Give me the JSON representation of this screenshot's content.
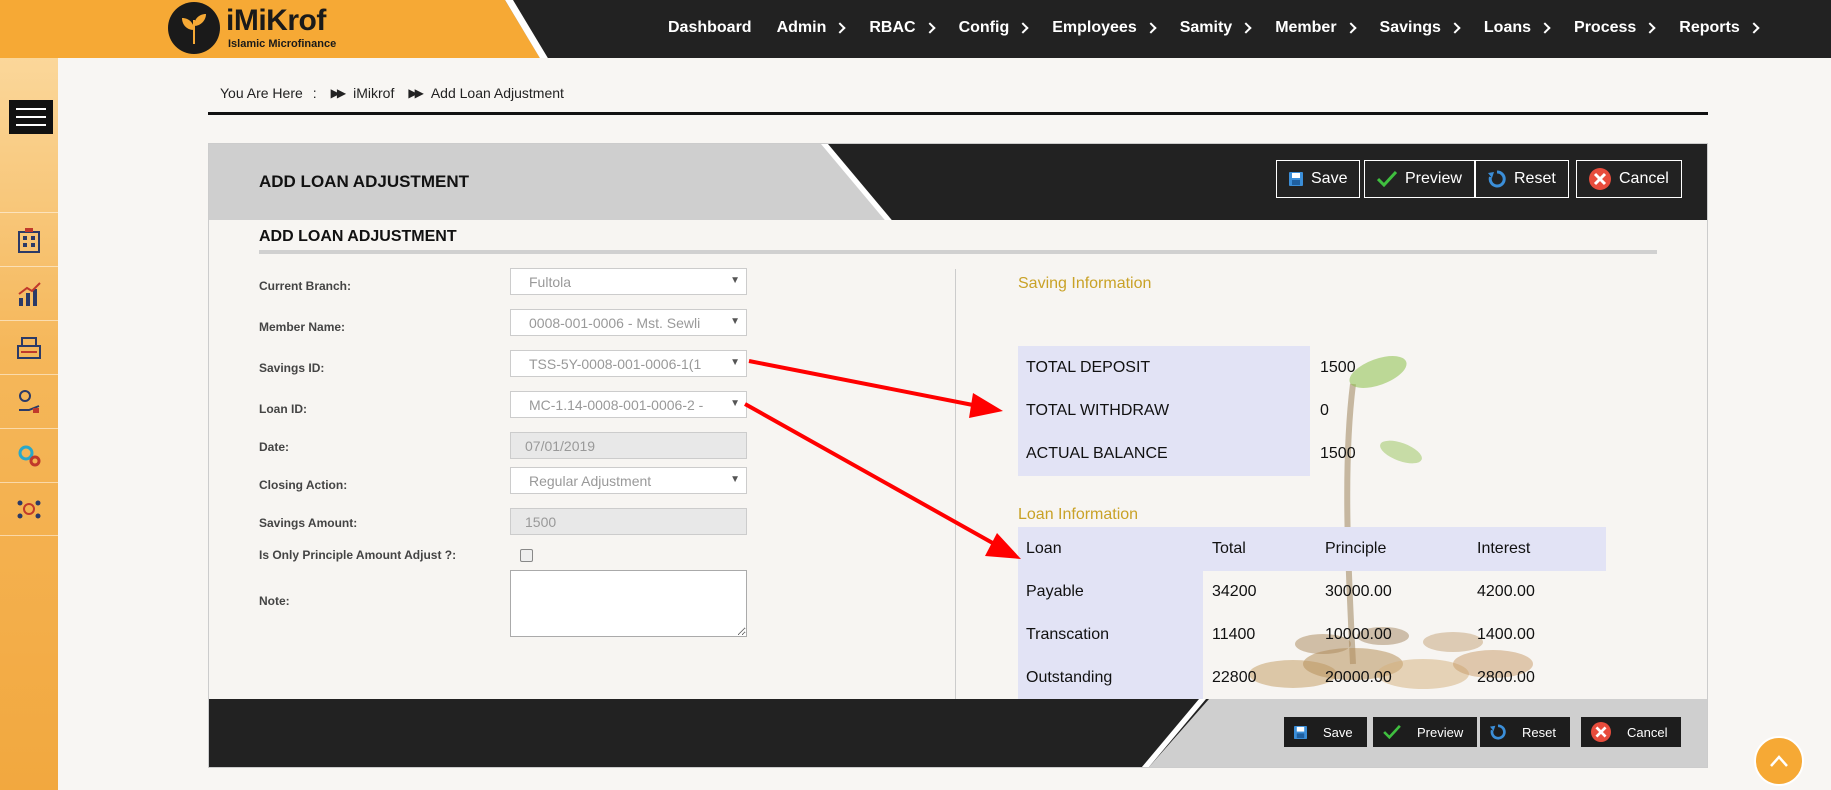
{
  "brand": {
    "title": "iMiKrof",
    "subtitle": "Islamic Microfinance"
  },
  "nav": {
    "items": [
      {
        "label": "Dashboard",
        "chevron": false
      },
      {
        "label": "Admin",
        "chevron": true
      },
      {
        "label": "RBAC",
        "chevron": true
      },
      {
        "label": "Config",
        "chevron": true
      },
      {
        "label": "Employees",
        "chevron": true
      },
      {
        "label": "Samity",
        "chevron": true
      },
      {
        "label": "Member",
        "chevron": true
      },
      {
        "label": "Savings",
        "chevron": true
      },
      {
        "label": "Loans",
        "chevron": true
      },
      {
        "label": "Process",
        "chevron": true
      },
      {
        "label": "Reports",
        "chevron": true
      }
    ]
  },
  "sidebar": {
    "icons": [
      "building-icon",
      "chart-icon",
      "cash-register-icon",
      "hand-money-icon",
      "gears-icon",
      "settings-people-icon"
    ]
  },
  "breadcrumb": {
    "prefix": "You Are Here",
    "colon": ":",
    "items": [
      "iMikrof",
      "Add Loan Adjustment"
    ]
  },
  "header": {
    "title": "ADD LOAN ADJUSTMENT",
    "buttons": {
      "save": "Save",
      "preview": "Preview",
      "reset": "Reset",
      "cancel": "Cancel"
    }
  },
  "form": {
    "section_title": "ADD LOAN ADJUSTMENT",
    "current_branch": {
      "label": "Current Branch:",
      "value": "Fultola"
    },
    "member_name": {
      "label": "Member Name:",
      "value": "0008-001-0006 - Mst. Sewli"
    },
    "savings_id": {
      "label": "Savings ID:",
      "value": "TSS-5Y-0008-001-0006-1(1"
    },
    "loan_id": {
      "label": "Loan ID:",
      "value": "MC-1.14-0008-001-0006-2 -"
    },
    "date": {
      "label": "Date:",
      "value": "07/01/2019"
    },
    "closing_action": {
      "label": "Closing Action:",
      "value": "Regular Adjustment"
    },
    "savings_amount": {
      "label": "Savings Amount:",
      "value": "1500"
    },
    "principle_only": {
      "label": "Is Only Principle Amount Adjust ?:",
      "checked": false
    },
    "note": {
      "label": "Note:",
      "value": ""
    }
  },
  "saving_info": {
    "title": "Saving Information",
    "rows": [
      {
        "label": "TOTAL DEPOSIT",
        "value": "1500"
      },
      {
        "label": "TOTAL WITHDRAW",
        "value": "0"
      },
      {
        "label": "ACTUAL BALANCE",
        "value": "1500"
      }
    ]
  },
  "loan_info": {
    "title": "Loan Information",
    "headers": [
      "Loan",
      "Total",
      "Principle",
      "Interest"
    ],
    "rows": [
      [
        "Payable",
        "34200",
        "30000.00",
        "4200.00"
      ],
      [
        "Transcation",
        "11400",
        "10000.00",
        "1400.00"
      ],
      [
        "Outstanding",
        "22800",
        "20000.00",
        "2800.00"
      ]
    ]
  },
  "footer": {
    "buttons": {
      "save": "Save",
      "preview": "Preview",
      "reset": "Reset",
      "cancel": "Cancel"
    }
  },
  "colors": {
    "accent": "#f6a935",
    "dark": "#222222",
    "annotation": "#ff0000",
    "gold": "#c9a227",
    "info_bg": "#e2e3f5"
  }
}
